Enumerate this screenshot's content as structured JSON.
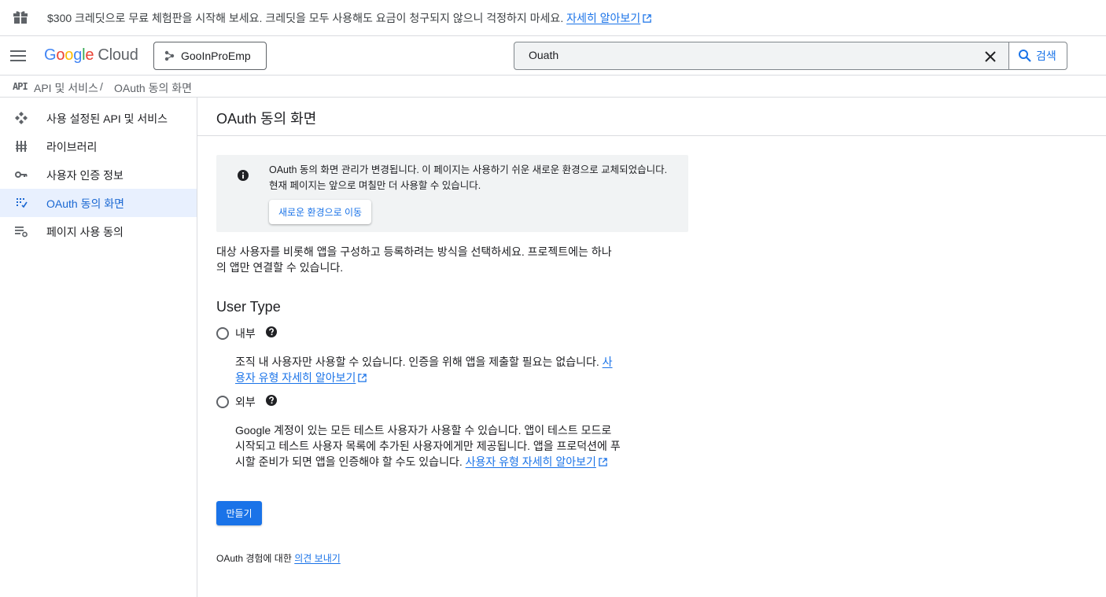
{
  "promo": {
    "text": "$300 크레딧으로 무료 체험판을 시작해 보세요. 크레딧을 모두 사용해도 요금이 청구되지 않으니 걱정하지 마세요.",
    "link": "자세히 알아보기"
  },
  "header": {
    "logo": {
      "g1": "G",
      "g2": "o",
      "g3": "o",
      "g4": "g",
      "g5": "l",
      "g6": "e",
      "cloud": "Cloud"
    },
    "project": "GooInProEmp",
    "search": {
      "value": "Ouath",
      "button": "검색"
    }
  },
  "breadcrumb": {
    "icon_text": "API",
    "items": [
      "API 및 서비스",
      "OAuth 동의 화면"
    ],
    "separator": "/"
  },
  "sidebar": {
    "items": [
      {
        "label": "사용 설정된 API 및 서비스",
        "icon": "api-hub-icon"
      },
      {
        "label": "라이브러리",
        "icon": "library-icon"
      },
      {
        "label": "사용자 인증 정보",
        "icon": "key-icon"
      },
      {
        "label": "OAuth 동의 화면",
        "icon": "consent-icon",
        "active": true
      },
      {
        "label": "페이지 사용 동의",
        "icon": "settings-list-icon"
      }
    ]
  },
  "main": {
    "title": "OAuth 동의 화면",
    "notice": {
      "message": "OAuth 동의 화면 관리가 변경됩니다. 이 페이지는 사용하기 쉬운 새로운 환경으로 교체되었습니다. 현재 페이지는 앞으로 며칠만 더 사용할 수 있습니다.",
      "button": "새로운 환경으로 이동"
    },
    "description": "대상 사용자를 비롯해 앱을 구성하고 등록하려는 방식을 선택하세요. 프로젝트에는 하나의 앱만 연결할 수 있습니다.",
    "user_type_title": "User Type",
    "internal": {
      "label": "내부",
      "description": "조직 내 사용자만 사용할 수 있습니다. 인증을 위해 앱을 제출할 필요는 없습니다.",
      "link": "사용자 유형 자세히 알아보기"
    },
    "external": {
      "label": "외부",
      "description": "Google 계정이 있는 모든 테스트 사용자가 사용할 수 있습니다. 앱이 테스트 모드로 시작되고 테스트 사용자 목록에 추가된 사용자에게만 제공됩니다. 앱을 프로덕션에 푸시할 준비가 되면 앱을 인증해야 할 수도 있습니다.",
      "link": "사용자 유형 자세히 알아보기"
    },
    "create_button": "만들기",
    "feedback": {
      "text": "OAuth 경험에 대한",
      "link": "의견 보내기"
    }
  },
  "colors": {
    "accent": "#1a73e8",
    "active_bg": "#e8f0fe",
    "notice_bg": "#f1f3f4"
  }
}
